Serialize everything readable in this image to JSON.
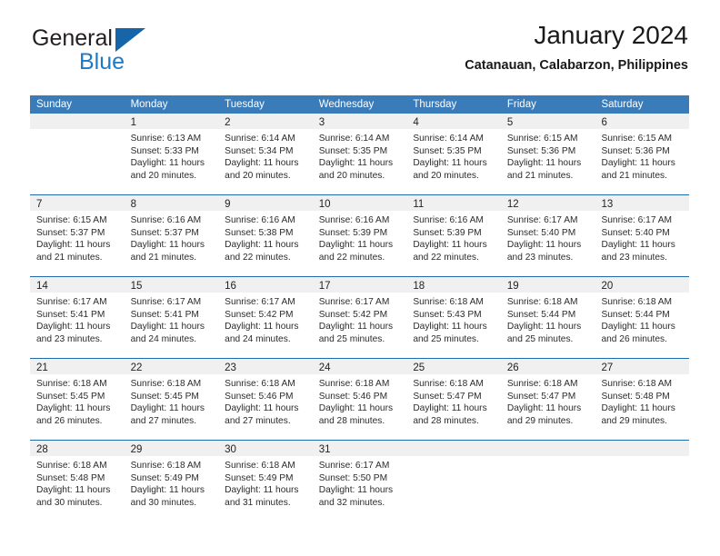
{
  "brand": {
    "name_part1": "General",
    "name_part2": "Blue",
    "triangle_color": "#1565a8"
  },
  "header": {
    "title": "January 2024",
    "subtitle": "Catanauan, Calabarzon, Philippines"
  },
  "theme": {
    "header_band": "#3a7cb9",
    "row_divider": "#1f6bab",
    "day_number_band": "#f0f0f0",
    "brand_blue": "#1f7ac4"
  },
  "weekdays": [
    "Sunday",
    "Monday",
    "Tuesday",
    "Wednesday",
    "Thursday",
    "Friday",
    "Saturday"
  ],
  "weeks": [
    [
      {
        "day": "",
        "empty": true,
        "l1": "",
        "l2": "",
        "l3": "",
        "l4": ""
      },
      {
        "day": "1",
        "l1": "Sunrise: 6:13 AM",
        "l2": "Sunset: 5:33 PM",
        "l3": "Daylight: 11 hours",
        "l4": "and 20 minutes."
      },
      {
        "day": "2",
        "l1": "Sunrise: 6:14 AM",
        "l2": "Sunset: 5:34 PM",
        "l3": "Daylight: 11 hours",
        "l4": "and 20 minutes."
      },
      {
        "day": "3",
        "l1": "Sunrise: 6:14 AM",
        "l2": "Sunset: 5:35 PM",
        "l3": "Daylight: 11 hours",
        "l4": "and 20 minutes."
      },
      {
        "day": "4",
        "l1": "Sunrise: 6:14 AM",
        "l2": "Sunset: 5:35 PM",
        "l3": "Daylight: 11 hours",
        "l4": "and 20 minutes."
      },
      {
        "day": "5",
        "l1": "Sunrise: 6:15 AM",
        "l2": "Sunset: 5:36 PM",
        "l3": "Daylight: 11 hours",
        "l4": "and 21 minutes."
      },
      {
        "day": "6",
        "l1": "Sunrise: 6:15 AM",
        "l2": "Sunset: 5:36 PM",
        "l3": "Daylight: 11 hours",
        "l4": "and 21 minutes."
      }
    ],
    [
      {
        "day": "7",
        "l1": "Sunrise: 6:15 AM",
        "l2": "Sunset: 5:37 PM",
        "l3": "Daylight: 11 hours",
        "l4": "and 21 minutes."
      },
      {
        "day": "8",
        "l1": "Sunrise: 6:16 AM",
        "l2": "Sunset: 5:37 PM",
        "l3": "Daylight: 11 hours",
        "l4": "and 21 minutes."
      },
      {
        "day": "9",
        "l1": "Sunrise: 6:16 AM",
        "l2": "Sunset: 5:38 PM",
        "l3": "Daylight: 11 hours",
        "l4": "and 22 minutes."
      },
      {
        "day": "10",
        "l1": "Sunrise: 6:16 AM",
        "l2": "Sunset: 5:39 PM",
        "l3": "Daylight: 11 hours",
        "l4": "and 22 minutes."
      },
      {
        "day": "11",
        "l1": "Sunrise: 6:16 AM",
        "l2": "Sunset: 5:39 PM",
        "l3": "Daylight: 11 hours",
        "l4": "and 22 minutes."
      },
      {
        "day": "12",
        "l1": "Sunrise: 6:17 AM",
        "l2": "Sunset: 5:40 PM",
        "l3": "Daylight: 11 hours",
        "l4": "and 23 minutes."
      },
      {
        "day": "13",
        "l1": "Sunrise: 6:17 AM",
        "l2": "Sunset: 5:40 PM",
        "l3": "Daylight: 11 hours",
        "l4": "and 23 minutes."
      }
    ],
    [
      {
        "day": "14",
        "l1": "Sunrise: 6:17 AM",
        "l2": "Sunset: 5:41 PM",
        "l3": "Daylight: 11 hours",
        "l4": "and 23 minutes."
      },
      {
        "day": "15",
        "l1": "Sunrise: 6:17 AM",
        "l2": "Sunset: 5:41 PM",
        "l3": "Daylight: 11 hours",
        "l4": "and 24 minutes."
      },
      {
        "day": "16",
        "l1": "Sunrise: 6:17 AM",
        "l2": "Sunset: 5:42 PM",
        "l3": "Daylight: 11 hours",
        "l4": "and 24 minutes."
      },
      {
        "day": "17",
        "l1": "Sunrise: 6:17 AM",
        "l2": "Sunset: 5:42 PM",
        "l3": "Daylight: 11 hours",
        "l4": "and 25 minutes."
      },
      {
        "day": "18",
        "l1": "Sunrise: 6:18 AM",
        "l2": "Sunset: 5:43 PM",
        "l3": "Daylight: 11 hours",
        "l4": "and 25 minutes."
      },
      {
        "day": "19",
        "l1": "Sunrise: 6:18 AM",
        "l2": "Sunset: 5:44 PM",
        "l3": "Daylight: 11 hours",
        "l4": "and 25 minutes."
      },
      {
        "day": "20",
        "l1": "Sunrise: 6:18 AM",
        "l2": "Sunset: 5:44 PM",
        "l3": "Daylight: 11 hours",
        "l4": "and 26 minutes."
      }
    ],
    [
      {
        "day": "21",
        "l1": "Sunrise: 6:18 AM",
        "l2": "Sunset: 5:45 PM",
        "l3": "Daylight: 11 hours",
        "l4": "and 26 minutes."
      },
      {
        "day": "22",
        "l1": "Sunrise: 6:18 AM",
        "l2": "Sunset: 5:45 PM",
        "l3": "Daylight: 11 hours",
        "l4": "and 27 minutes."
      },
      {
        "day": "23",
        "l1": "Sunrise: 6:18 AM",
        "l2": "Sunset: 5:46 PM",
        "l3": "Daylight: 11 hours",
        "l4": "and 27 minutes."
      },
      {
        "day": "24",
        "l1": "Sunrise: 6:18 AM",
        "l2": "Sunset: 5:46 PM",
        "l3": "Daylight: 11 hours",
        "l4": "and 28 minutes."
      },
      {
        "day": "25",
        "l1": "Sunrise: 6:18 AM",
        "l2": "Sunset: 5:47 PM",
        "l3": "Daylight: 11 hours",
        "l4": "and 28 minutes."
      },
      {
        "day": "26",
        "l1": "Sunrise: 6:18 AM",
        "l2": "Sunset: 5:47 PM",
        "l3": "Daylight: 11 hours",
        "l4": "and 29 minutes."
      },
      {
        "day": "27",
        "l1": "Sunrise: 6:18 AM",
        "l2": "Sunset: 5:48 PM",
        "l3": "Daylight: 11 hours",
        "l4": "and 29 minutes."
      }
    ],
    [
      {
        "day": "28",
        "l1": "Sunrise: 6:18 AM",
        "l2": "Sunset: 5:48 PM",
        "l3": "Daylight: 11 hours",
        "l4": "and 30 minutes."
      },
      {
        "day": "29",
        "l1": "Sunrise: 6:18 AM",
        "l2": "Sunset: 5:49 PM",
        "l3": "Daylight: 11 hours",
        "l4": "and 30 minutes."
      },
      {
        "day": "30",
        "l1": "Sunrise: 6:18 AM",
        "l2": "Sunset: 5:49 PM",
        "l3": "Daylight: 11 hours",
        "l4": "and 31 minutes."
      },
      {
        "day": "31",
        "l1": "Sunrise: 6:17 AM",
        "l2": "Sunset: 5:50 PM",
        "l3": "Daylight: 11 hours",
        "l4": "and 32 minutes."
      },
      {
        "day": "",
        "empty": true,
        "l1": "",
        "l2": "",
        "l3": "",
        "l4": ""
      },
      {
        "day": "",
        "empty": true,
        "l1": "",
        "l2": "",
        "l3": "",
        "l4": ""
      },
      {
        "day": "",
        "empty": true,
        "l1": "",
        "l2": "",
        "l3": "",
        "l4": ""
      }
    ]
  ]
}
